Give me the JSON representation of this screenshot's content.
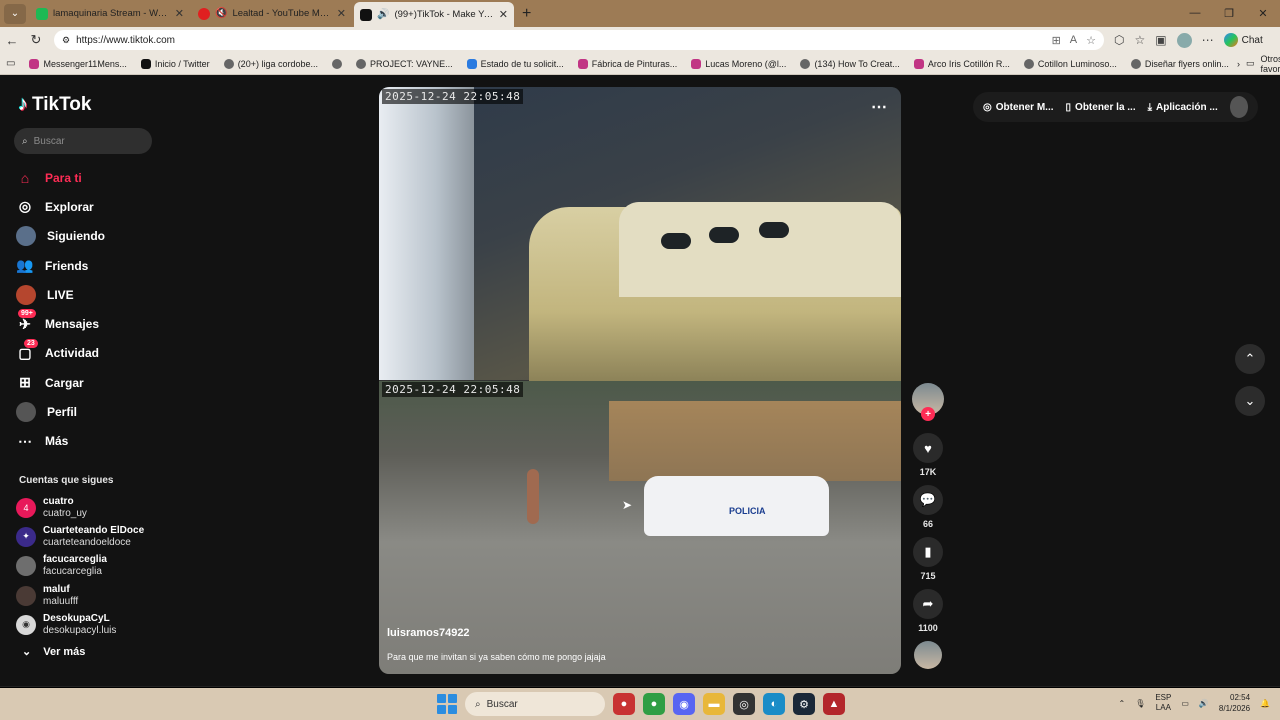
{
  "tabs": [
    {
      "title": "lamaquinaria Stream - Watch Live",
      "color": "#1db954",
      "active": false
    },
    {
      "title": "Lealtad - YouTube Music",
      "color": "#e02020",
      "active": false
    },
    {
      "title": "(99+)TikTok - Make Your Day",
      "color": "#111111",
      "active": true
    }
  ],
  "address": {
    "url": "https://www.tiktok.com"
  },
  "browser": {
    "chat_label": "Chat",
    "new_tab": "+"
  },
  "bookmarks": [
    {
      "label": "Messenger11Mens...",
      "color": "#c13584"
    },
    {
      "label": "Inicio / Twitter",
      "color": "#111111"
    },
    {
      "label": "(20+) liga cordobe...",
      "color": "#666666"
    },
    {
      "label": "",
      "color": "#666666"
    },
    {
      "label": "PROJECT: VAYNE...",
      "color": "#666666"
    },
    {
      "label": "Estado de tu solicit...",
      "color": "#2b7be0"
    },
    {
      "label": "Fábrica de Pinturas...",
      "color": "#c13584"
    },
    {
      "label": "Lucas Moreno (@l...",
      "color": "#c13584"
    },
    {
      "label": "(134) How To Creat...",
      "color": "#666666"
    },
    {
      "label": "Arco Iris Cotillón R...",
      "color": "#c13584"
    },
    {
      "label": "Cotillon Luminoso...",
      "color": "#666666"
    },
    {
      "label": "Diseñar flyers onlin...",
      "color": "#666666"
    }
  ],
  "bookmarks_other": "Otros favoritos",
  "sidebar": {
    "brand": "TikTok",
    "search_placeholder": "Buscar",
    "nav": [
      {
        "label": "Para ti",
        "icon": "home-icon",
        "active": true
      },
      {
        "label": "Explorar",
        "icon": "compass-icon"
      },
      {
        "label": "Siguiendo",
        "icon": "following-avatar-icon"
      },
      {
        "label": "Friends",
        "icon": "friends-icon"
      },
      {
        "label": "LIVE",
        "icon": "live-icon"
      },
      {
        "label": "Mensajes",
        "icon": "messages-icon",
        "badge": "99+"
      },
      {
        "label": "Actividad",
        "icon": "activity-icon",
        "badge": "23"
      },
      {
        "label": "Cargar",
        "icon": "upload-icon"
      },
      {
        "label": "Perfil",
        "icon": "profile-icon"
      },
      {
        "label": "Más",
        "icon": "more-icon"
      }
    ],
    "following_title": "Cuentas que sigues",
    "following": [
      {
        "name": "cuatro",
        "handle": "cuatro_uy",
        "color": "#e8195a"
      },
      {
        "name": "Cuarteteando ElDoce",
        "handle": "cuarteteandoeldoce",
        "color": "#3b2a8a"
      },
      {
        "name": "facucarceglia",
        "handle": "facucarceglia",
        "color": "#6e6e6e"
      },
      {
        "name": "maluf",
        "handle": "maluufff",
        "color": "#4a3a35"
      },
      {
        "name": "DesokupaCyL",
        "handle": "desokupacyl.luis",
        "color": "#d8d8d8"
      }
    ],
    "see_more": "Ver más"
  },
  "video": {
    "timestamp_top": "2025-12-24 22:05:48",
    "timestamp_bottom": "2025-12-24 22:05:48",
    "username": "luisramos74922",
    "caption": "Para que me invitan si ya saben cómo me pongo jajaja",
    "police_text": "POLICIA"
  },
  "actions": {
    "likes": "17K",
    "comments": "66",
    "saves": "715",
    "shares": "1100"
  },
  "topbar": {
    "item1": "Obtener M...",
    "item2": "Obtener la ...",
    "item3": "Aplicación ..."
  },
  "taskbar": {
    "search": "Buscar",
    "lang1": "ESP",
    "lang2": "LAA",
    "time": "02:54",
    "date": "8/1/2026"
  }
}
